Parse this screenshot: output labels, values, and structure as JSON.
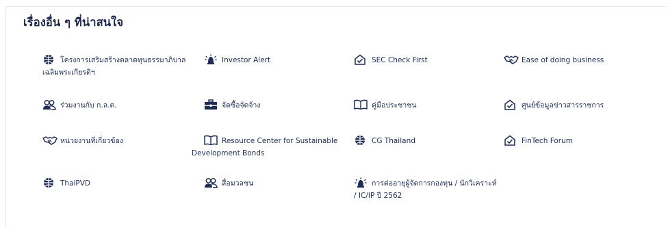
{
  "section": {
    "title": "เรื่องอื่น ๆ ที่น่าสนใจ"
  },
  "items": [
    {
      "label": "โครงการเสริมสร้างตลาดทุนธรรมาภิบาลเฉลิมพระเกียรติฯ",
      "icon": "globe-icon"
    },
    {
      "label": "Investor Alert",
      "icon": "alert-siren-icon"
    },
    {
      "label": "SEC Check First",
      "icon": "envelope-check-icon"
    },
    {
      "label": "Ease of doing business",
      "icon": "handshake-icon"
    },
    {
      "label": "ร่วมงานกับ ก.ล.ต.",
      "icon": "people-icon"
    },
    {
      "label": "จัดซื้อจัดจ้าง",
      "icon": "briefcase-icon"
    },
    {
      "label": "คู่มือประชาชน",
      "icon": "book-icon"
    },
    {
      "label": "ศูนย์ข้อมูลข่าวสารราชการ",
      "icon": "envelope-check-icon"
    },
    {
      "label": "หน่วยงานที่เกี่ยวข้อง",
      "icon": "handshake-icon"
    },
    {
      "label": "Resource Center for Sustainable Development Bonds",
      "icon": "book-icon"
    },
    {
      "label": "CG Thailand",
      "icon": "globe-icon"
    },
    {
      "label": "FinTech Forum",
      "icon": "envelope-check-icon"
    },
    {
      "label": "ThaiPVD",
      "icon": "globe-icon"
    },
    {
      "label": "สื่อมวลชน",
      "icon": "people-icon"
    },
    {
      "label": "การต่ออายุผู้จัดการกองทุน / นักวิเคราะห์ / IC/IP ปี 2562",
      "icon": "alert-siren-icon"
    }
  ],
  "colors": {
    "text": "#1e2c55",
    "icon": "#1e2c55",
    "border": "#e4e6ea"
  }
}
